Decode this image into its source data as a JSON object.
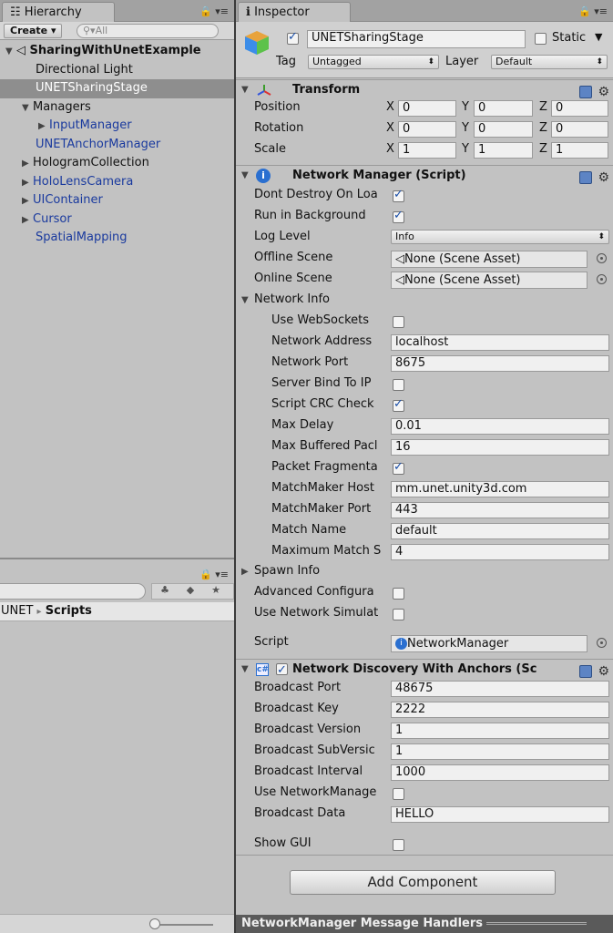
{
  "hierarchy": {
    "tab_label": "Hierarchy",
    "create_label": "Create",
    "search_placeholder": "All",
    "items": [
      {
        "label": "SharingWithUnetExample",
        "indent": 0,
        "expanded": true
      },
      {
        "label": "Directional Light"
      },
      {
        "label": "UNETSharingStage",
        "selected": true
      },
      {
        "label": "Managers",
        "expanded": true
      },
      {
        "label": "InputManager"
      },
      {
        "label": "UNETAnchorManager"
      },
      {
        "label": "HologramCollection"
      },
      {
        "label": "HoloLensCamera"
      },
      {
        "label": "UIContainer"
      },
      {
        "label": "Cursor"
      },
      {
        "label": "SpatialMapping"
      }
    ]
  },
  "project": {
    "breadcrumb_parent": "UNET",
    "breadcrumb_separator": "▸",
    "breadcrumb_current": "Scripts"
  },
  "inspector": {
    "tab_label": "Inspector",
    "object_name": "UNETSharingStage",
    "static_label": "Static",
    "tag_label": "Tag",
    "tag_value": "Untagged",
    "layer_label": "Layer",
    "layer_value": "Default",
    "transform": {
      "title": "Transform",
      "position_label": "Position",
      "rotation_label": "Rotation",
      "scale_label": "Scale",
      "axis_x": "X",
      "axis_y": "Y",
      "axis_z": "Z",
      "position": [
        "0",
        "0",
        "0"
      ],
      "rotation": [
        "0",
        "0",
        "0"
      ],
      "scale": [
        "1",
        "1",
        "1"
      ]
    },
    "network_manager": {
      "title": "Network Manager (Script)",
      "dont_destroy": "Dont Destroy On Loa",
      "run_in_background": "Run in Background",
      "log_level_label": "Log Level",
      "log_level_value": "Info",
      "offline_scene_label": "Offline Scene",
      "offline_scene_value": "None (Scene Asset)",
      "online_scene_label": "Online Scene",
      "online_scene_value": "None (Scene Asset)",
      "network_info_label": "Network Info",
      "use_websockets": "Use WebSockets",
      "network_address_label": "Network Address",
      "network_address_value": "localhost",
      "network_port_label": "Network Port",
      "network_port_value": "8675",
      "server_bind": "Server Bind To IP",
      "script_crc": "Script CRC Check",
      "max_delay_label": "Max Delay",
      "max_delay_value": "0.01",
      "max_buffered_label": "Max Buffered Pacl",
      "max_buffered_value": "16",
      "packet_frag": "Packet Fragmenta",
      "matchmaker_host_label": "MatchMaker Host",
      "matchmaker_host_value": "mm.unet.unity3d.com",
      "matchmaker_port_label": "MatchMaker Port",
      "matchmaker_port_value": "443",
      "match_name_label": "Match Name",
      "match_name_value": "default",
      "max_match_label": "Maximum Match S",
      "max_match_value": "4",
      "spawn_info_label": "Spawn Info",
      "advanced_config": "Advanced Configura",
      "use_network_sim": "Use Network Simulat",
      "script_label": "Script",
      "script_value": "NetworkManager"
    },
    "discovery": {
      "title": "Network Discovery With Anchors (Sc",
      "broadcast_port_label": "Broadcast Port",
      "broadcast_port_value": "48675",
      "broadcast_key_label": "Broadcast Key",
      "broadcast_key_value": "2222",
      "broadcast_version_label": "Broadcast Version",
      "broadcast_version_value": "1",
      "broadcast_subversion_label": "Broadcast SubVersic",
      "broadcast_subversion_value": "1",
      "broadcast_interval_label": "Broadcast Interval",
      "broadcast_interval_value": "1000",
      "use_network_manager": "Use NetworkManage",
      "broadcast_data_label": "Broadcast Data",
      "broadcast_data_value": "HELLO",
      "show_gui": "Show GUI"
    },
    "add_component_label": "Add Component",
    "message_handlers_label": "NetworkManager Message Handlers"
  }
}
